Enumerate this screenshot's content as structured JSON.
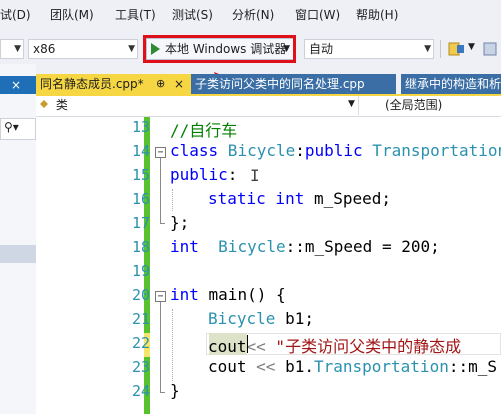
{
  "menu": {
    "items": [
      "试(D)",
      "团队(M)",
      "工具(T)",
      "测试(S)",
      "分析(N)",
      "窗口(W)",
      "帮助(H)"
    ]
  },
  "toolbar": {
    "config_value": "",
    "platform_value": "x86",
    "run_label": "本地 Windows 调试器",
    "run_mode_value": "自动"
  },
  "tabs": [
    {
      "label": "同名静态成员.cpp*",
      "pin": "⊕",
      "close": "×"
    },
    {
      "label": "子类访问父类中的同名处理.cpp"
    },
    {
      "label": "继承中的构造和析"
    }
  ],
  "navbar": {
    "scope_left": "类",
    "scope_right": "(全局范围)"
  },
  "editor": {
    "line_numbers": [
      "13",
      "14",
      "15",
      "16",
      "17",
      "18",
      "19",
      "20",
      "21",
      "22",
      "23",
      "24"
    ],
    "lines": {
      "l13": "//自行车",
      "l14_kw": "class",
      "l14_name": " Bicycle",
      "l14_colon": ":",
      "l14_kw2": "public",
      "l14_base": " Transportation",
      "l15_kw": "public",
      "l15_rest": ":",
      "l16_kw": "static",
      "l16_kw2": " int",
      "l16_rest": " m_Speed;",
      "l17": "};",
      "l18_kw": "int",
      "l18_cls": "  Bicycle",
      "l18_rest": "::m_Speed = 200;",
      "l20_kw": "int",
      "l20_rest": " main() {",
      "l21_cls": "Bicycle",
      "l21_rest": " b1;",
      "l22_a": "cout",
      "l22_op": "<<",
      "l22_str": " \"子类访问父类中的静态成",
      "l23_a": "cout",
      "l23_op": " <<",
      "l23_b": " b1.",
      "l23_cls": "Transportation",
      "l23_rest": "::m_S",
      "l24": "}"
    }
  }
}
